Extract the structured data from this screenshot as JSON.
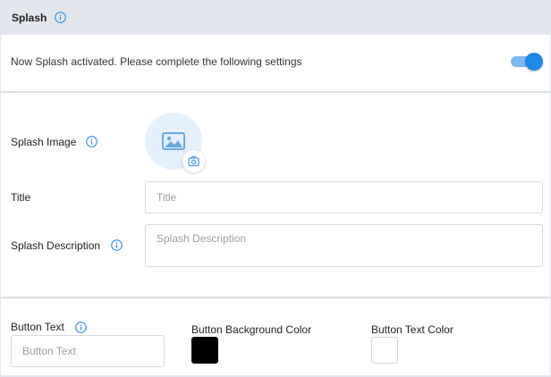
{
  "header": {
    "title": "Splash",
    "info_icon": "info-circle-icon"
  },
  "activation": {
    "message": "Now Splash activated. Please complete the following settings",
    "toggle_on": true,
    "toggle_color": "#1e88e5"
  },
  "fields": {
    "splash_image": {
      "label": "Splash Image",
      "placeholder_icon": "image-icon",
      "upload_icon": "camera-icon"
    },
    "title": {
      "label": "Title",
      "value": "",
      "placeholder": "Title"
    },
    "splash_description": {
      "label": "Splash Description",
      "value": "",
      "placeholder": "Splash Description"
    },
    "button_text": {
      "label": "Button Text",
      "value": "",
      "placeholder": "Button Text"
    },
    "button_background_color": {
      "label": "Button Background Color",
      "color": "#000000"
    },
    "button_text_color": {
      "label": "Button Text Color",
      "color": "#ffffff"
    }
  },
  "colors": {
    "accent": "#1e88e5",
    "header_bg": "#e3e6ec"
  }
}
